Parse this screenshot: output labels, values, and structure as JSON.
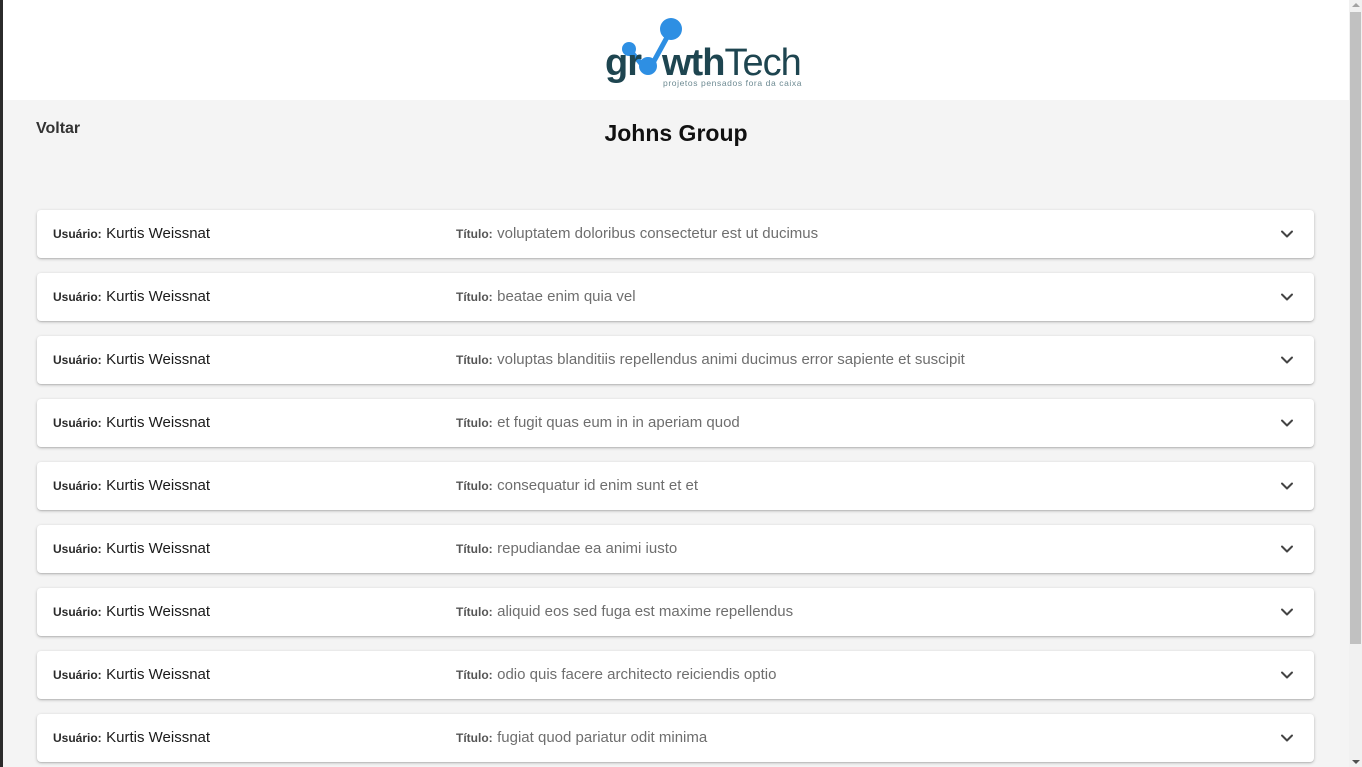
{
  "brand": {
    "logo_main": "gr",
    "logo_mid": "wth",
    "logo_tech": "Tech",
    "tagline": "projetos pensados fora da caixa",
    "colors": {
      "primary": "#1e4550",
      "accent": "#2e8fe3",
      "tagline": "#6d8a92"
    }
  },
  "nav": {
    "back_label": "Voltar"
  },
  "page": {
    "title": "Johns Group"
  },
  "labels": {
    "user": "Usuário:",
    "title": "Título:"
  },
  "posts": [
    {
      "user": "Kurtis Weissnat",
      "title": "voluptatem doloribus consectetur est ut ducimus"
    },
    {
      "user": "Kurtis Weissnat",
      "title": "beatae enim quia vel"
    },
    {
      "user": "Kurtis Weissnat",
      "title": "voluptas blanditiis repellendus animi ducimus error sapiente et suscipit"
    },
    {
      "user": "Kurtis Weissnat",
      "title": "et fugit quas eum in in aperiam quod"
    },
    {
      "user": "Kurtis Weissnat",
      "title": "consequatur id enim sunt et et"
    },
    {
      "user": "Kurtis Weissnat",
      "title": "repudiandae ea animi iusto"
    },
    {
      "user": "Kurtis Weissnat",
      "title": "aliquid eos sed fuga est maxime repellendus"
    },
    {
      "user": "Kurtis Weissnat",
      "title": "odio quis facere architecto reiciendis optio"
    },
    {
      "user": "Kurtis Weissnat",
      "title": "fugiat quod pariatur odit minima"
    }
  ],
  "icons": {
    "expand": "chevron-down-icon"
  }
}
